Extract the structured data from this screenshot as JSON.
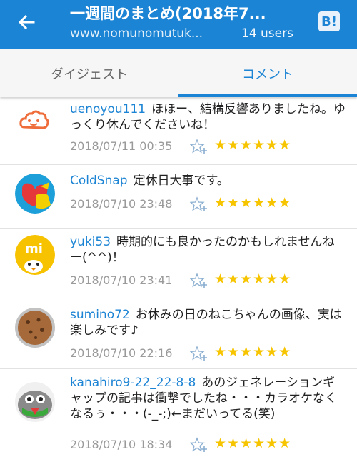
{
  "header": {
    "title": "一週間のまとめ(2018年7...",
    "url": "www.nomunomutuk...",
    "users": "14 users",
    "logo_text": "B!",
    "color": "#1c84d4"
  },
  "tabs": [
    {
      "label": "ダイジェスト",
      "active": false
    },
    {
      "label": "コメント",
      "active": true
    }
  ],
  "comments": [
    {
      "user": "uenoyou111",
      "text": "ほほー、結構反響ありましたね。ゆっくり休んでくださいね！",
      "date": "2018/07/11 00:35",
      "stars": "★★★★★★",
      "avatar": "cloud-face-icon"
    },
    {
      "user": "ColdSnap",
      "text": "定休日大事です。",
      "date": "2018/07/10 23:48",
      "stars": "★★★★★★",
      "avatar": "heart-globe-icon"
    },
    {
      "user": "yuki53",
      "text": "時期的にも良かったのかもしれませんねー(^^)！",
      "date": "2018/07/10 23:41",
      "stars": "★★★★★★",
      "avatar": "mi-duck-icon"
    },
    {
      "user": "sumino72",
      "text": "お休みの日のねこちゃんの画像、実は楽しみです♪",
      "date": "2018/07/10 22:16",
      "stars": "★★★★★★",
      "avatar": "cookie-icon"
    },
    {
      "user": "kanahiro9-22_22-8-8",
      "text": "あのジェネレーションギャップの記事は衝撃でしたね・・・カラオケなくなるぅ・・・(-_-;)←まだいってる(笑)",
      "date": "2018/07/10 18:34",
      "stars": "★★★★★★",
      "avatar": "green-character-icon"
    }
  ]
}
